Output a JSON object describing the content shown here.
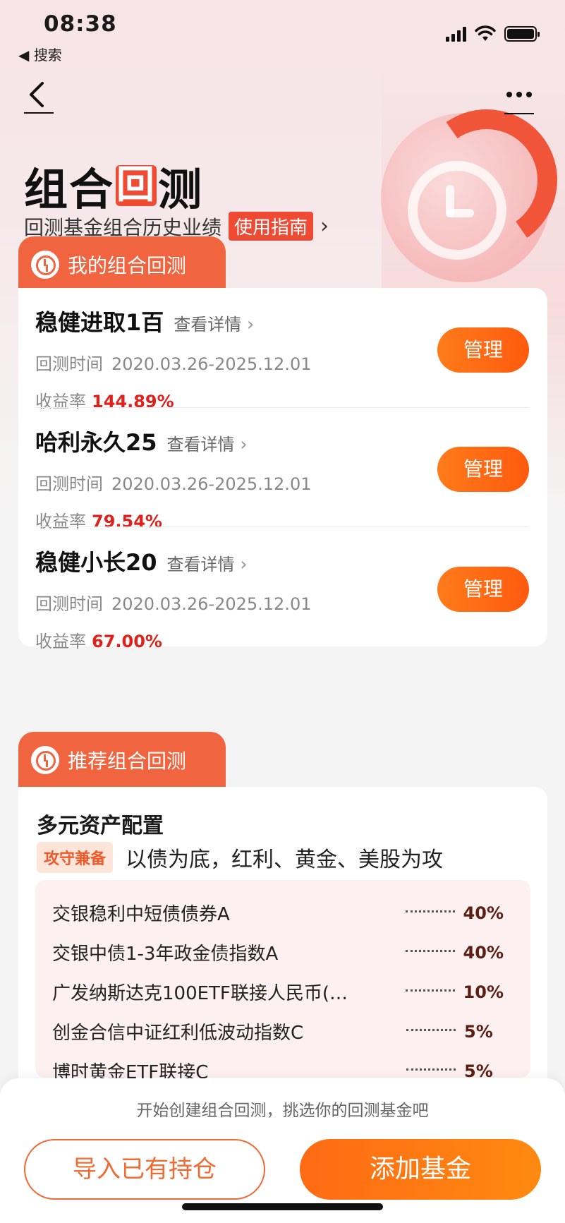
{
  "status_bar": {
    "time": "08:38",
    "back_label": "◀ 搜索"
  },
  "header": {
    "title_pre": "组合",
    "title_box": "回",
    "title_post": "测",
    "subtitle": "回测基金组合历史业绩",
    "guide_tag": "使用指南",
    "guide_arrow": "›"
  },
  "my_section": {
    "tab_label": "我的组合回测",
    "items": [
      {
        "name": "稳健进取1百",
        "link": "查看详情",
        "time_label": "回测时间",
        "time_value": "2020.03.26-2025.12.01",
        "rate_label": "收益率",
        "rate_value": "144.89%",
        "button": "管理"
      },
      {
        "name": "哈利永久25",
        "link": "查看详情",
        "time_label": "回测时间",
        "time_value": "2020.03.26-2025.12.01",
        "rate_label": "收益率",
        "rate_value": "79.54%",
        "button": "管理"
      },
      {
        "name": "稳健小长20",
        "link": "查看详情",
        "time_label": "回测时间",
        "time_value": "2020.03.26-2025.12.01",
        "rate_label": "收益率",
        "rate_value": "67.00%",
        "button": "管理"
      }
    ]
  },
  "recommend_section": {
    "tab_label": "推荐组合回测",
    "title": "多元资产配置",
    "tag": "攻守兼备",
    "desc": "以债为底，红利、黄金、美股为攻",
    "funds": [
      {
        "name": "交银稳利中短债债券A",
        "pct": "40%"
      },
      {
        "name": "交银中债1-3年政金债指数A",
        "pct": "40%"
      },
      {
        "name": "广发纳斯达克100ETF联接人民币(…",
        "pct": "10%"
      },
      {
        "name": "创金合信中证红利低波动指数C",
        "pct": "5%"
      },
      {
        "name": "博时黄金ETF联接C",
        "pct": "5%"
      }
    ]
  },
  "bottom_bar": {
    "hint": "开始创建组合回测，挑选你的回测基金吧",
    "import_button": "导入已有持仓",
    "add_button": "添加基金"
  },
  "colors": {
    "accent": "#f06440",
    "orange_button": "#ff6a14",
    "rate_red": "#e0201a"
  }
}
